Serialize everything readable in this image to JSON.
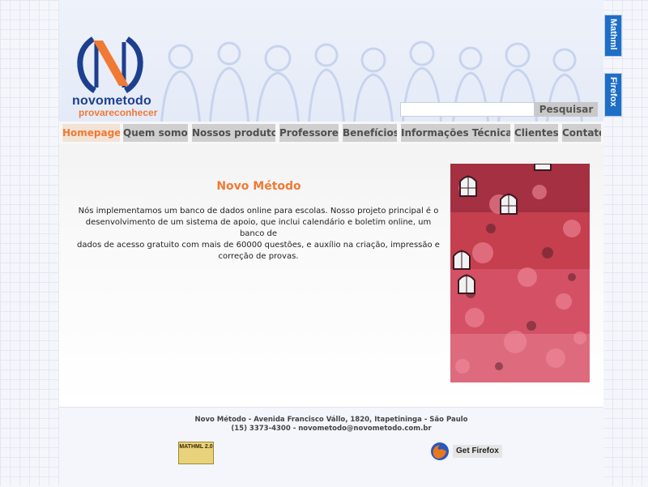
{
  "logo": {
    "name": "novometodo",
    "tagline": "provareconhecer"
  },
  "search": {
    "value": "",
    "button_label": "Pesquisar"
  },
  "nav": {
    "tabs": [
      {
        "label": "Homepage",
        "active": true
      },
      {
        "label": "Quem somos",
        "active": false
      },
      {
        "label": "Nossos produtos",
        "active": false
      },
      {
        "label": "Professores",
        "active": false
      },
      {
        "label": "Benefícios",
        "active": false
      },
      {
        "label": "Informações Técnicas",
        "active": false
      },
      {
        "label": "Clientes",
        "active": false
      },
      {
        "label": "Contato",
        "active": false
      }
    ]
  },
  "main": {
    "title": "Novo Método",
    "lines": [
      "Nós implementamos um banco de dados online para escolas. Nosso projeto principal é o",
      "desenvolvimento de um sistema de apoio, que inclui calendário e boletim online, um banco de",
      "dados de acesso gratuito com mais de 60000 questões, e auxílio na criação, impressão e",
      "correção de provas."
    ]
  },
  "footer": {
    "address": "Novo Método - Avenida Francisco Vállo, 1820, Itapetininga - São Paulo",
    "contact": "(15) 3373-4300 - novometodo@novometodo.com.br",
    "mathml_badge": "MATHML 2.0",
    "firefox_badge": "Get Firefox"
  },
  "side_tabs": [
    "Mathml",
    "Firefox"
  ],
  "colors": {
    "accent_orange": "#f07a34",
    "logo_blue": "#1d3f8f",
    "tab_gray": "#cfcfcf",
    "side_tab_blue": "#1e6ec8"
  }
}
